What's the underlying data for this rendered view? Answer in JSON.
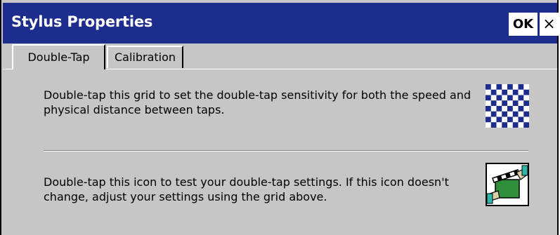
{
  "window": {
    "title": "Stylus Properties",
    "ok_label": "OK",
    "close_label": "×"
  },
  "tabs": [
    {
      "label": "Double-Tap",
      "active": true
    },
    {
      "label": "Calibration",
      "active": false
    }
  ],
  "double_tap": {
    "grid_description": "Double-tap this grid to set the double-tap sensitivity for both the speed and physical distance between taps.",
    "test_description": "Double-tap this icon to test your double-tap settings. If this icon doesn't change, adjust your settings using the grid above."
  },
  "colors": {
    "titlebar": "#1c2d8d",
    "face": "#c6c6c6",
    "grid_dark": "#1c2d8d",
    "grid_light": "#ffffff",
    "icon_green": "#2f8f3a"
  },
  "icons": {
    "grid": "checkerboard-grid-icon",
    "test": "clapperboard-hands-icon"
  }
}
